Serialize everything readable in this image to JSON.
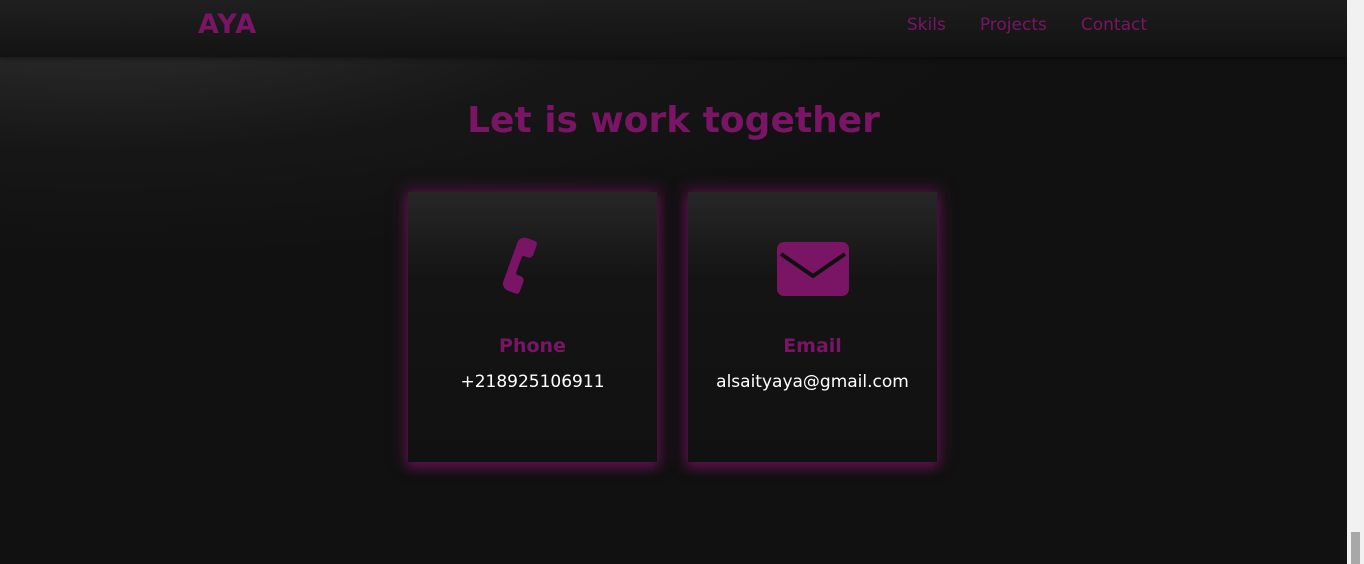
{
  "brand": {
    "logo": "AYA",
    "accent_color": "#7a1566"
  },
  "nav": {
    "links": [
      {
        "label": "Skils"
      },
      {
        "label": "Projects"
      },
      {
        "label": "Contact"
      }
    ]
  },
  "contact_section": {
    "title": "Let is work together",
    "cards": [
      {
        "icon": "phone-icon",
        "label": "Phone",
        "value": "+218925106911"
      },
      {
        "icon": "envelope-icon",
        "label": "Email",
        "value": "alsaityaya@gmail.com"
      }
    ]
  }
}
